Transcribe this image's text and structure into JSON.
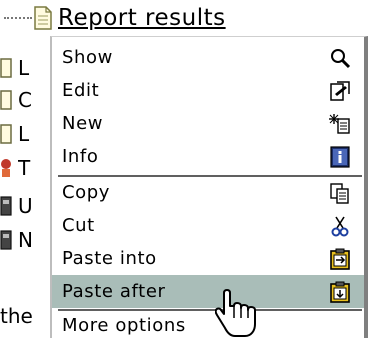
{
  "tree": {
    "root_label": "Report results",
    "rows": [
      {
        "text": "L",
        "icon": "document-icon"
      },
      {
        "text": "C",
        "icon": "document-icon"
      },
      {
        "text": "L",
        "icon": "document-icon"
      },
      {
        "text": "T",
        "icon": "person-icon"
      },
      {
        "text": "U",
        "icon": "dark-document-icon"
      },
      {
        "text": "N",
        "icon": "dark-document-icon"
      }
    ],
    "bottom_text": "the"
  },
  "menu": {
    "items": [
      {
        "label": "Show",
        "icon": "magnifier-icon"
      },
      {
        "label": "Edit",
        "icon": "edit-icon"
      },
      {
        "label": "New",
        "icon": "new-sparkle-icon"
      },
      {
        "label": "Info",
        "icon": "info-icon"
      },
      {
        "label": "Copy",
        "icon": "copy-icon"
      },
      {
        "label": "Cut",
        "icon": "scissors-icon"
      },
      {
        "label": "Paste into",
        "icon": "paste-into-icon"
      },
      {
        "label": "Paste after",
        "icon": "paste-after-icon"
      },
      {
        "label": "More options",
        "icon": "more-options-icon"
      }
    ],
    "highlighted_index": 7,
    "highlight_color": "#a9bdb8"
  }
}
